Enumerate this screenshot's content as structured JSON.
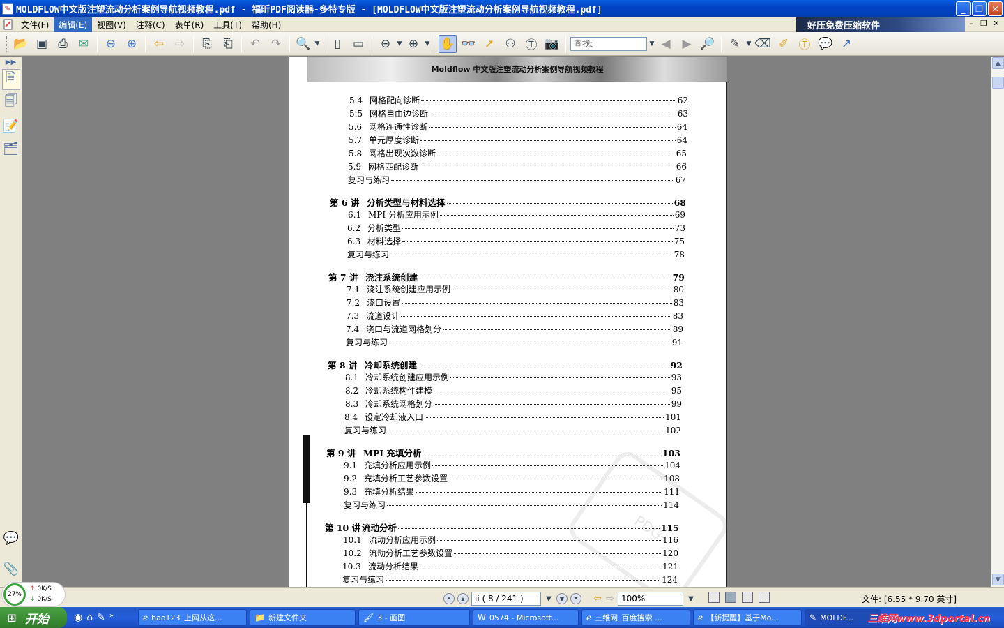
{
  "window": {
    "title": "MOLDFLOW中文版注塑流动分析案例导航视频教程.pdf - 福昕PDF阅读器-多特专版 - [MOLDFLOW中文版注塑流动分析案例导航视频教程.pdf]"
  },
  "menu": {
    "items": [
      "文件(F)",
      "编辑(E)",
      "视图(V)",
      "注释(C)",
      "表单(R)",
      "工具(T)",
      "帮助(H)"
    ],
    "active_index": 1,
    "ad_text": "好压免费压缩软件"
  },
  "toolbar": {
    "search_placeholder": "查找:"
  },
  "document": {
    "page_header": "Moldflow 中文版注塑流动分析案例导航视频教程",
    "toc": [
      {
        "type": "item",
        "num": "5.4",
        "label": "网格配向诊断",
        "page": "62"
      },
      {
        "type": "item",
        "num": "5.5",
        "label": "网格自由边诊断",
        "page": "63"
      },
      {
        "type": "item",
        "num": "5.6",
        "label": "网格连通性诊断",
        "page": "64"
      },
      {
        "type": "item",
        "num": "5.7",
        "label": "单元厚度诊断",
        "page": "64"
      },
      {
        "type": "item",
        "num": "5.8",
        "label": "网格出现次数诊断",
        "page": "65"
      },
      {
        "type": "item",
        "num": "5.9",
        "label": "网格匹配诊断",
        "page": "66"
      },
      {
        "type": "review",
        "label": "复习与练习",
        "page": "67"
      },
      {
        "type": "chapter",
        "num": "第 6 讲",
        "label": "分析类型与材料选择",
        "page": "68"
      },
      {
        "type": "item",
        "num": "6.1",
        "label": "MPI 分析应用示例",
        "page": "69"
      },
      {
        "type": "item",
        "num": "6.2",
        "label": "分析类型",
        "page": "73"
      },
      {
        "type": "item",
        "num": "6.3",
        "label": "材料选择",
        "page": "75"
      },
      {
        "type": "review",
        "label": "复习与练习",
        "page": "78"
      },
      {
        "type": "chapter",
        "num": "第 7 讲",
        "label": "浇注系统创建",
        "page": "79"
      },
      {
        "type": "item",
        "num": "7.1",
        "label": "浇注系统创建应用示例",
        "page": "80"
      },
      {
        "type": "item",
        "num": "7.2",
        "label": "浇口设置",
        "page": "83"
      },
      {
        "type": "item",
        "num": "7.3",
        "label": "流道设计",
        "page": "83"
      },
      {
        "type": "item",
        "num": "7.4",
        "label": "浇口与流道网格划分",
        "page": "89"
      },
      {
        "type": "review",
        "label": "复习与练习",
        "page": "91"
      },
      {
        "type": "chapter",
        "num": "第 8 讲",
        "label": "冷却系统创建",
        "page": "92"
      },
      {
        "type": "item",
        "num": "8.1",
        "label": "冷却系统创建应用示例",
        "page": "93"
      },
      {
        "type": "item",
        "num": "8.2",
        "label": "冷却系统构件建模",
        "page": "95"
      },
      {
        "type": "item",
        "num": "8.3",
        "label": "冷却系统网格划分",
        "page": "99"
      },
      {
        "type": "item",
        "num": "8.4",
        "label": "设定冷却液入口",
        "page": "101"
      },
      {
        "type": "review",
        "label": "复习与练习",
        "page": "102"
      },
      {
        "type": "chapter",
        "num": "第 9 讲",
        "label": "MPI 充填分析",
        "page": "103"
      },
      {
        "type": "item",
        "num": "9.1",
        "label": "充填分析应用示例",
        "page": "104"
      },
      {
        "type": "item",
        "num": "9.2",
        "label": "充填分析工艺参数设置",
        "page": "108"
      },
      {
        "type": "item",
        "num": "9.3",
        "label": "充填分析结果",
        "page": "111"
      },
      {
        "type": "review",
        "label": "复习与练习",
        "page": "114"
      },
      {
        "type": "chapter",
        "num": "第 10 讲",
        "label": "流动分析",
        "page": "115"
      },
      {
        "type": "item",
        "num": "10.1",
        "label": "流动分析应用示例",
        "page": "116"
      },
      {
        "type": "item",
        "num": "10.2",
        "label": "流动分析工艺参数设置",
        "page": "120"
      },
      {
        "type": "item",
        "num": "10.3",
        "label": "流动分析结果",
        "page": "121"
      },
      {
        "type": "review",
        "label": "复习与练习",
        "page": "124"
      }
    ]
  },
  "statusbar": {
    "net_percent": "27%",
    "up_rate": "0K/S",
    "down_rate": "0K/S",
    "page_indicator": "ii ( 8 / 241 )",
    "zoom": "100%",
    "file_size": "文件: [6.55 * 9.70 英寸]"
  },
  "taskbar": {
    "start_label": "开始",
    "tasks": [
      {
        "icon": "ie-icon",
        "label": "hao123_上网从这..."
      },
      {
        "icon": "folder-icon",
        "label": "新建文件夹"
      },
      {
        "icon": "paint-icon",
        "label": "3 - 画图"
      },
      {
        "icon": "word-icon",
        "label": "0574 - Microsoft..."
      },
      {
        "icon": "ie-icon",
        "label": "三维网_百度搜索 ..."
      },
      {
        "icon": "ie-icon",
        "label": "【新提醒】基于Mo..."
      },
      {
        "icon": "pdf-icon",
        "label": "MOLDF..."
      }
    ],
    "brand": "三维网www.3dportal.cn"
  }
}
